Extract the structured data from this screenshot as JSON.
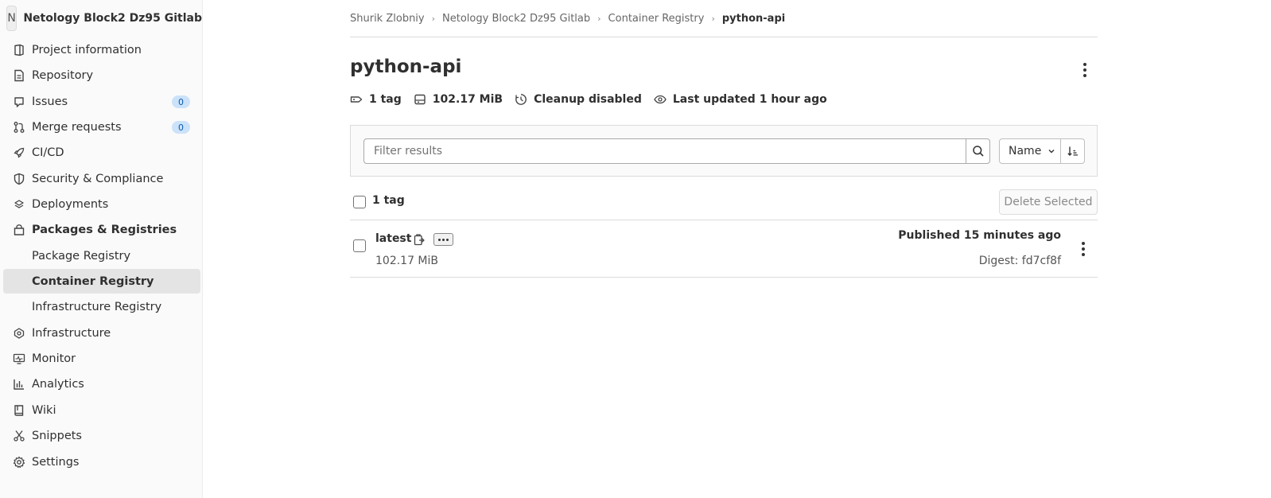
{
  "sidebar": {
    "project_initial": "N",
    "project_name": "Netology Block2 Dz95 Gitlab",
    "items": [
      {
        "label": "Project information",
        "icon": "info-icon"
      },
      {
        "label": "Repository",
        "icon": "document-icon"
      },
      {
        "label": "Issues",
        "icon": "issues-icon",
        "badge": "0"
      },
      {
        "label": "Merge requests",
        "icon": "merge-request-icon",
        "badge": "0"
      },
      {
        "label": "CI/CD",
        "icon": "rocket-icon"
      },
      {
        "label": "Security & Compliance",
        "icon": "shield-icon"
      },
      {
        "label": "Deployments",
        "icon": "deployments-icon"
      },
      {
        "label": "Packages & Registries",
        "icon": "package-icon"
      },
      {
        "label": "Infrastructure",
        "icon": "cloud-icon"
      },
      {
        "label": "Monitor",
        "icon": "monitor-icon"
      },
      {
        "label": "Analytics",
        "icon": "chart-icon"
      },
      {
        "label": "Wiki",
        "icon": "book-icon"
      },
      {
        "label": "Snippets",
        "icon": "scissors-icon"
      },
      {
        "label": "Settings",
        "icon": "gear-icon"
      }
    ],
    "subitems": [
      {
        "label": "Package Registry"
      },
      {
        "label": "Container Registry"
      },
      {
        "label": "Infrastructure Registry"
      }
    ]
  },
  "breadcrumb": [
    "Shurik Zlobniy",
    "Netology Block2 Dz95 Gitlab",
    "Container Registry",
    "python-api"
  ],
  "header": {
    "title": "python-api",
    "tag_count": "1 tag",
    "size": "102.17 MiB",
    "cleanup": "Cleanup disabled",
    "last_updated": "Last updated 1 hour ago"
  },
  "filter": {
    "placeholder": "Filter results",
    "sort_label": "Name"
  },
  "tags_header": {
    "count": "1 tag",
    "delete_label": "Delete Selected"
  },
  "tags": [
    {
      "name": "latest",
      "size": "102.17 MiB",
      "published": "Published 15 minutes ago",
      "digest": "Digest: fd7cf8f"
    }
  ],
  "colors": {
    "badge_bg": "#cbe2f9",
    "badge_text": "#0b5cad",
    "active_item_bg": "#e4e4e4"
  }
}
